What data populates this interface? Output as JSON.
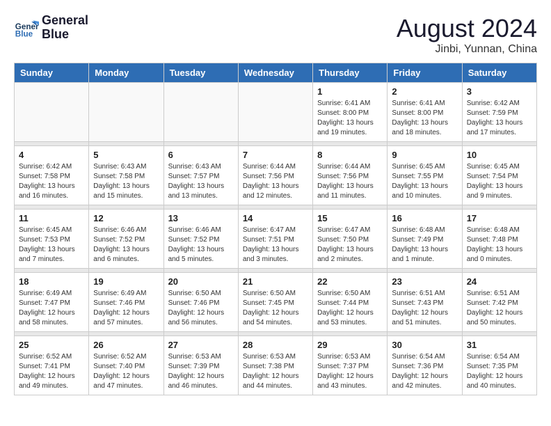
{
  "logo": {
    "line1": "General",
    "line2": "Blue"
  },
  "title": "August 2024",
  "subtitle": "Jinbi, Yunnan, China",
  "days_of_week": [
    "Sunday",
    "Monday",
    "Tuesday",
    "Wednesday",
    "Thursday",
    "Friday",
    "Saturday"
  ],
  "weeks": [
    [
      {
        "day": "",
        "info": ""
      },
      {
        "day": "",
        "info": ""
      },
      {
        "day": "",
        "info": ""
      },
      {
        "day": "",
        "info": ""
      },
      {
        "day": "1",
        "info": "Sunrise: 6:41 AM\nSunset: 8:00 PM\nDaylight: 13 hours\nand 19 minutes."
      },
      {
        "day": "2",
        "info": "Sunrise: 6:41 AM\nSunset: 8:00 PM\nDaylight: 13 hours\nand 18 minutes."
      },
      {
        "day": "3",
        "info": "Sunrise: 6:42 AM\nSunset: 7:59 PM\nDaylight: 13 hours\nand 17 minutes."
      }
    ],
    [
      {
        "day": "4",
        "info": "Sunrise: 6:42 AM\nSunset: 7:58 PM\nDaylight: 13 hours\nand 16 minutes."
      },
      {
        "day": "5",
        "info": "Sunrise: 6:43 AM\nSunset: 7:58 PM\nDaylight: 13 hours\nand 15 minutes."
      },
      {
        "day": "6",
        "info": "Sunrise: 6:43 AM\nSunset: 7:57 PM\nDaylight: 13 hours\nand 13 minutes."
      },
      {
        "day": "7",
        "info": "Sunrise: 6:44 AM\nSunset: 7:56 PM\nDaylight: 13 hours\nand 12 minutes."
      },
      {
        "day": "8",
        "info": "Sunrise: 6:44 AM\nSunset: 7:56 PM\nDaylight: 13 hours\nand 11 minutes."
      },
      {
        "day": "9",
        "info": "Sunrise: 6:45 AM\nSunset: 7:55 PM\nDaylight: 13 hours\nand 10 minutes."
      },
      {
        "day": "10",
        "info": "Sunrise: 6:45 AM\nSunset: 7:54 PM\nDaylight: 13 hours\nand 9 minutes."
      }
    ],
    [
      {
        "day": "11",
        "info": "Sunrise: 6:45 AM\nSunset: 7:53 PM\nDaylight: 13 hours\nand 7 minutes."
      },
      {
        "day": "12",
        "info": "Sunrise: 6:46 AM\nSunset: 7:52 PM\nDaylight: 13 hours\nand 6 minutes."
      },
      {
        "day": "13",
        "info": "Sunrise: 6:46 AM\nSunset: 7:52 PM\nDaylight: 13 hours\nand 5 minutes."
      },
      {
        "day": "14",
        "info": "Sunrise: 6:47 AM\nSunset: 7:51 PM\nDaylight: 13 hours\nand 3 minutes."
      },
      {
        "day": "15",
        "info": "Sunrise: 6:47 AM\nSunset: 7:50 PM\nDaylight: 13 hours\nand 2 minutes."
      },
      {
        "day": "16",
        "info": "Sunrise: 6:48 AM\nSunset: 7:49 PM\nDaylight: 13 hours\nand 1 minute."
      },
      {
        "day": "17",
        "info": "Sunrise: 6:48 AM\nSunset: 7:48 PM\nDaylight: 13 hours\nand 0 minutes."
      }
    ],
    [
      {
        "day": "18",
        "info": "Sunrise: 6:49 AM\nSunset: 7:47 PM\nDaylight: 12 hours\nand 58 minutes."
      },
      {
        "day": "19",
        "info": "Sunrise: 6:49 AM\nSunset: 7:46 PM\nDaylight: 12 hours\nand 57 minutes."
      },
      {
        "day": "20",
        "info": "Sunrise: 6:50 AM\nSunset: 7:46 PM\nDaylight: 12 hours\nand 56 minutes."
      },
      {
        "day": "21",
        "info": "Sunrise: 6:50 AM\nSunset: 7:45 PM\nDaylight: 12 hours\nand 54 minutes."
      },
      {
        "day": "22",
        "info": "Sunrise: 6:50 AM\nSunset: 7:44 PM\nDaylight: 12 hours\nand 53 minutes."
      },
      {
        "day": "23",
        "info": "Sunrise: 6:51 AM\nSunset: 7:43 PM\nDaylight: 12 hours\nand 51 minutes."
      },
      {
        "day": "24",
        "info": "Sunrise: 6:51 AM\nSunset: 7:42 PM\nDaylight: 12 hours\nand 50 minutes."
      }
    ],
    [
      {
        "day": "25",
        "info": "Sunrise: 6:52 AM\nSunset: 7:41 PM\nDaylight: 12 hours\nand 49 minutes."
      },
      {
        "day": "26",
        "info": "Sunrise: 6:52 AM\nSunset: 7:40 PM\nDaylight: 12 hours\nand 47 minutes."
      },
      {
        "day": "27",
        "info": "Sunrise: 6:53 AM\nSunset: 7:39 PM\nDaylight: 12 hours\nand 46 minutes."
      },
      {
        "day": "28",
        "info": "Sunrise: 6:53 AM\nSunset: 7:38 PM\nDaylight: 12 hours\nand 44 minutes."
      },
      {
        "day": "29",
        "info": "Sunrise: 6:53 AM\nSunset: 7:37 PM\nDaylight: 12 hours\nand 43 minutes."
      },
      {
        "day": "30",
        "info": "Sunrise: 6:54 AM\nSunset: 7:36 PM\nDaylight: 12 hours\nand 42 minutes."
      },
      {
        "day": "31",
        "info": "Sunrise: 6:54 AM\nSunset: 7:35 PM\nDaylight: 12 hours\nand 40 minutes."
      }
    ]
  ]
}
